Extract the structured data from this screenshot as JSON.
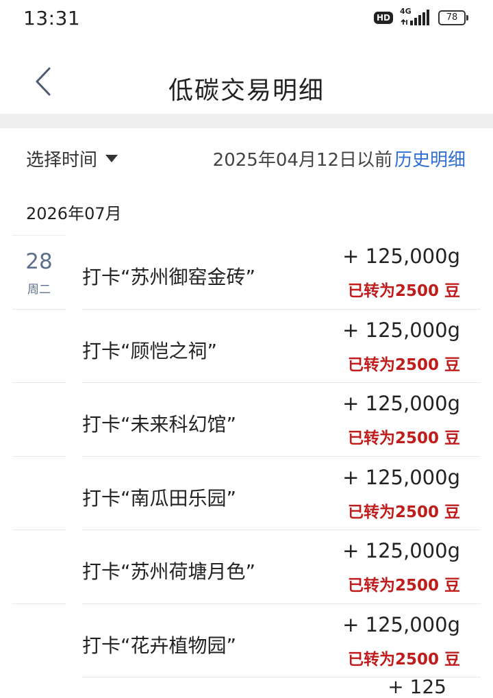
{
  "status": {
    "time": "13:31",
    "hd": "HD",
    "network": "4G",
    "battery": "78"
  },
  "nav": {
    "title": "低碳交易明细"
  },
  "filter": {
    "time_select_label": "选择时间",
    "before_date": "2025年04月12日以前",
    "history_link": "历史明细"
  },
  "month": "2026年07月",
  "first_day": {
    "day": "28",
    "weekday": "周二"
  },
  "records": [
    {
      "title": "打卡“苏州御窑金砖”",
      "amount": "+ 125,000g",
      "beans": "已转为2500 豆"
    },
    {
      "title": "打卡“顾恺之祠”",
      "amount": "+ 125,000g",
      "beans": "已转为2500 豆"
    },
    {
      "title": "打卡“未来科幻馆”",
      "amount": "+ 125,000g",
      "beans": "已转为2500 豆"
    },
    {
      "title": "打卡“南瓜田乐园”",
      "amount": "+ 125,000g",
      "beans": "已转为2500 豆"
    },
    {
      "title": "打卡“苏州荷塘月色”",
      "amount": "+ 125,000g",
      "beans": "已转为2500 豆"
    },
    {
      "title": "打卡“花卉植物园”",
      "amount": "+ 125,000g",
      "beans": "已转为2500 豆"
    }
  ],
  "partial_next": "+ 125"
}
